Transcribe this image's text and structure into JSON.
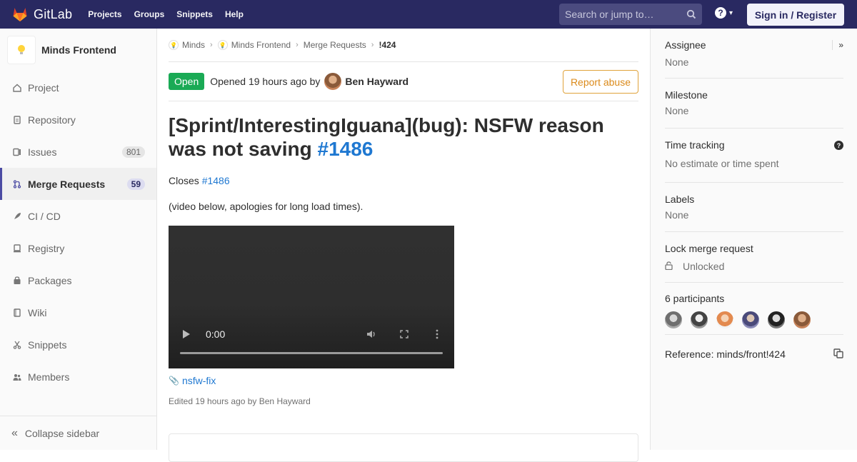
{
  "navbar": {
    "brand": "GitLab",
    "links": [
      "Projects",
      "Groups",
      "Snippets",
      "Help"
    ],
    "search_placeholder": "Search or jump to…",
    "signin_label": "Sign in / Register"
  },
  "sidebar": {
    "project_name": "Minds Frontend",
    "items": [
      {
        "label": "Project",
        "icon": "home-icon",
        "count": ""
      },
      {
        "label": "Repository",
        "icon": "file-icon",
        "count": ""
      },
      {
        "label": "Issues",
        "icon": "issues-icon",
        "count": "801"
      },
      {
        "label": "Merge Requests",
        "icon": "merge-request-icon",
        "count": "59"
      },
      {
        "label": "CI / CD",
        "icon": "rocket-icon",
        "count": ""
      },
      {
        "label": "Registry",
        "icon": "container-icon",
        "count": ""
      },
      {
        "label": "Packages",
        "icon": "package-icon",
        "count": ""
      },
      {
        "label": "Wiki",
        "icon": "book-icon",
        "count": ""
      },
      {
        "label": "Snippets",
        "icon": "scissors-icon",
        "count": ""
      },
      {
        "label": "Members",
        "icon": "users-icon",
        "count": ""
      }
    ],
    "collapse_label": "Collapse sidebar"
  },
  "breadcrumbs": [
    "Minds",
    "Minds Frontend",
    "Merge Requests",
    "!424"
  ],
  "header": {
    "status": "Open",
    "opened_text": "Opened 19 hours ago by",
    "author": "Ben Hayward",
    "report_label": "Report abuse"
  },
  "mr": {
    "title_text": "[Sprint/InterestingIguana](bug): NSFW reason was not saving ",
    "title_ref": "#1486",
    "closes_label": "Closes ",
    "closes_ref": "#1486",
    "note": "(video below, apologies for long load times).",
    "video_time": "0:00",
    "attachment": "nsfw-fix",
    "edited": "Edited 19 hours ago by Ben Hayward"
  },
  "right": {
    "assignee_title": "Assignee",
    "assignee_value": "None",
    "milestone_title": "Milestone",
    "milestone_value": "None",
    "time_title": "Time tracking",
    "time_value": "No estimate or time spent",
    "labels_title": "Labels",
    "labels_value": "None",
    "lock_title": "Lock merge request",
    "lock_value": "Unlocked",
    "participants_title": "6 participants",
    "reference": "Reference: minds/front!424"
  },
  "colors": {
    "navbar": "#292961",
    "open_badge": "#1aaa55",
    "link": "#1f78d1",
    "report": "#db8a1a"
  }
}
